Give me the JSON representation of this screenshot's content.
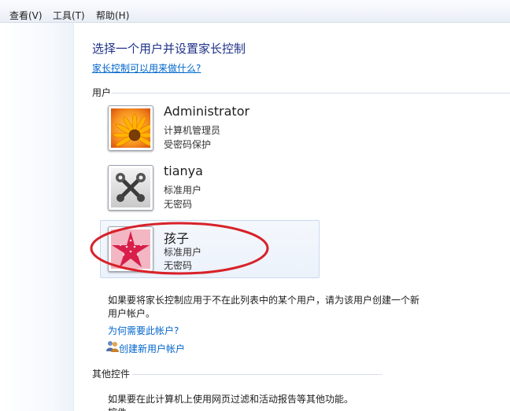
{
  "menu": {
    "view": "查看(V)",
    "tools": "工具(T)",
    "help": "帮助(H)"
  },
  "main": {
    "title": "选择一个用户并设置家长控制",
    "help_link": "家长控制可以用来做什么?",
    "users_section_label": "用户",
    "users": [
      {
        "name": "Administrator",
        "type": "计算机管理员",
        "password": "受密码保护",
        "avatar": "flower-avatar-icon"
      },
      {
        "name": "tianya",
        "type": "标准用户",
        "password": "无密码",
        "avatar": "tools-avatar-icon"
      },
      {
        "name": "孩子",
        "type": "标准用户",
        "password": "无密码",
        "avatar": "starfish-avatar-icon"
      }
    ],
    "not_listed_text_line1": "如果要将家长控制应用于不在此列表中的某个用户，请为该用户创建一个新",
    "not_listed_text_line2": "用户帐户。",
    "why_account_link": "为何需要此帐户?",
    "create_account_link": "创建新用户帐户",
    "other_controls_label": "其他控件",
    "other_controls_text": "如果要在此计算机上使用网页过滤和活动报告等其他功能。",
    "other_controls_cutoff": "控件"
  },
  "colors": {
    "title": "#1e3287",
    "link": "#0066cc",
    "highlight": "#d8222a",
    "selected_bg": "#ecf2fb"
  }
}
